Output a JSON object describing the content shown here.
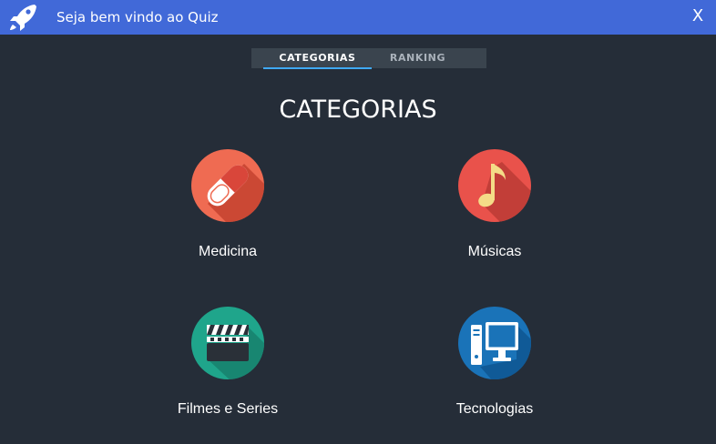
{
  "window": {
    "title": "Seja bem vindo ao Quiz",
    "close_label": "X",
    "app_icon": "rocket-icon"
  },
  "tabs": [
    {
      "label": "CATEGORIAS",
      "active": true
    },
    {
      "label": "RANKING",
      "active": false
    }
  ],
  "main": {
    "heading": "CATEGORIAS",
    "categories": [
      {
        "label": "Medicina",
        "icon": "pill-icon",
        "color": "#ef6b52"
      },
      {
        "label": "Músicas",
        "icon": "music-note-icon",
        "color": "#e9524b"
      },
      {
        "label": "Filmes e Series",
        "icon": "clapperboard-icon",
        "color": "#1fa58b"
      },
      {
        "label": "Tecnologias",
        "icon": "computer-icon",
        "color": "#1a73b8"
      }
    ]
  },
  "colors": {
    "titlebar": "#4169d8",
    "background": "#252d38",
    "tab_bar": "#3a444e",
    "tab_indicator": "#3fa9f5"
  }
}
